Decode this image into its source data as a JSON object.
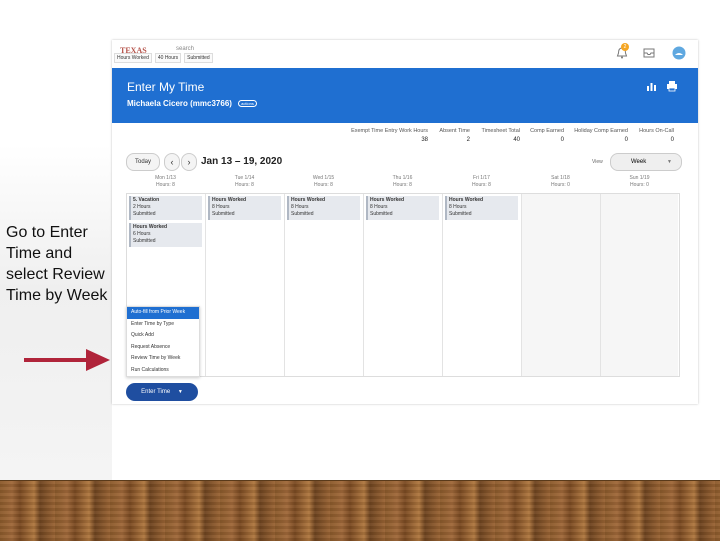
{
  "instruction": {
    "text": " Go to Enter Time and select Review Time by Week"
  },
  "app": {
    "logo_text": "TEXAS",
    "search_fragment": "search",
    "tabs": [
      "Hours Worked",
      "40 Hours",
      "Submitted"
    ],
    "notification_count": "2"
  },
  "header": {
    "title": "Enter My Time",
    "subtitle": "Michaela Cicero (mmc3766)",
    "subtitle_badge": "actions"
  },
  "summary": [
    {
      "label": "Exempt Time Entry Work Hours",
      "value": "38"
    },
    {
      "label": "Absent Time",
      "value": "2"
    },
    {
      "label": "Timesheet Total",
      "value": "40"
    },
    {
      "label": "Comp Earned",
      "value": "0"
    },
    {
      "label": "Holiday Comp Earned",
      "value": "0"
    },
    {
      "label": "Hours On-Call",
      "value": "0"
    }
  ],
  "controls": {
    "today_label": "Today",
    "prev_symbol": "‹",
    "next_symbol": "›",
    "date_range": "Jan 13 – 19, 2020",
    "view_label": "View",
    "view_value": "Week",
    "view_caret": "▼"
  },
  "days": [
    {
      "name": "Mon 1/13",
      "hours": "Hours: 8"
    },
    {
      "name": "Tue 1/14",
      "hours": "Hours: 8"
    },
    {
      "name": "Wed 1/15",
      "hours": "Hours: 8"
    },
    {
      "name": "Thu 1/16",
      "hours": "Hours: 8"
    },
    {
      "name": "Fri 1/17",
      "hours": "Hours: 8"
    },
    {
      "name": "Sat 1/18",
      "hours": "Hours: 0"
    },
    {
      "name": "Sun 1/19",
      "hours": "Hours: 0"
    }
  ],
  "blocks": [
    {
      "title": "5. Vacation",
      "hours": "2 Hours",
      "status": "Submitted"
    },
    {
      "title": "Hours Worked",
      "hours": "6 Hours",
      "status": "Submitted"
    },
    {
      "title": "Hours Worked",
      "hours": "8 Hours",
      "status": "Submitted"
    },
    {
      "title": "Hours Worked",
      "hours": "8 Hours",
      "status": "Submitted"
    },
    {
      "title": "Hours Worked",
      "hours": "8 Hours",
      "status": "Submitted"
    },
    {
      "title": "Hours Worked",
      "hours": "8 Hours",
      "status": "Submitted"
    }
  ],
  "menu": {
    "items": [
      "Auto-fill from Prior Week",
      "Enter Time by Type",
      "Quick Add",
      "Request Absence",
      "Review Time by Week",
      "Run Calculations"
    ]
  },
  "enter_time_button": {
    "label": "Enter Time",
    "caret": "▼"
  },
  "colors": {
    "header_blue": "#1f6fd1",
    "button_navy": "#1f4ea0",
    "arrow_red": "#b0243a"
  }
}
